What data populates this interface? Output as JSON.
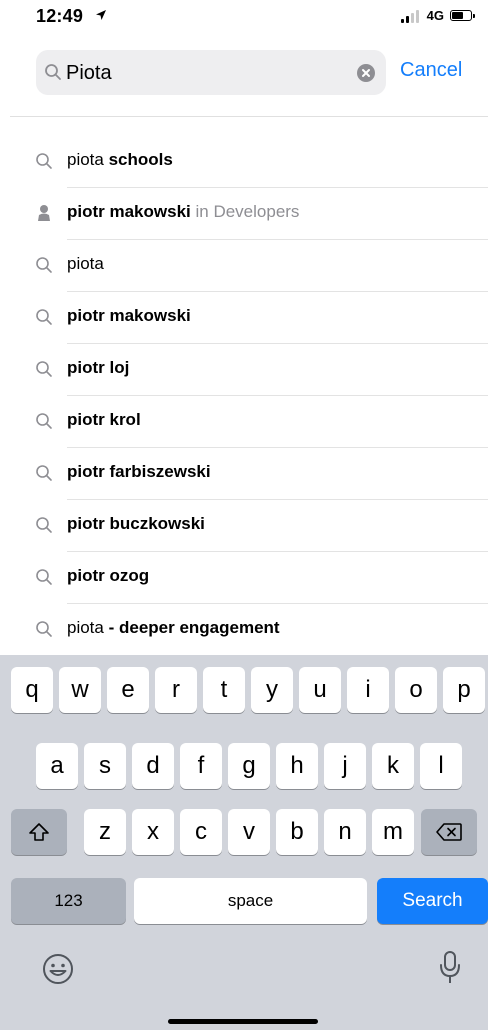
{
  "status": {
    "time": "12:49",
    "network": "4G"
  },
  "search": {
    "query": "Piota",
    "cancel_label": "Cancel"
  },
  "suggestions": [
    {
      "icon": "search-icon",
      "prefix": "piota",
      "bold": " schools",
      "context": ""
    },
    {
      "icon": "person-icon",
      "prefix": "",
      "bold": "piotr makowski",
      "context": " in Developers"
    },
    {
      "icon": "search-icon",
      "prefix": "piota",
      "bold": "",
      "context": ""
    },
    {
      "icon": "search-icon",
      "prefix": "",
      "bold": "piotr makowski",
      "context": ""
    },
    {
      "icon": "search-icon",
      "prefix": "",
      "bold": "piotr loj",
      "context": ""
    },
    {
      "icon": "search-icon",
      "prefix": "",
      "bold": "piotr krol",
      "context": ""
    },
    {
      "icon": "search-icon",
      "prefix": "",
      "bold": "piotr farbiszewski",
      "context": ""
    },
    {
      "icon": "search-icon",
      "prefix": "",
      "bold": "piotr buczkowski",
      "context": ""
    },
    {
      "icon": "search-icon",
      "prefix": "",
      "bold": "piotr ozog",
      "context": ""
    },
    {
      "icon": "search-icon",
      "prefix": "piota",
      "bold": " - deeper engagement",
      "context": ""
    }
  ],
  "keyboard": {
    "row1": [
      "q",
      "w",
      "e",
      "r",
      "t",
      "y",
      "u",
      "i",
      "o",
      "p"
    ],
    "row2": [
      "a",
      "s",
      "d",
      "f",
      "g",
      "h",
      "j",
      "k",
      "l"
    ],
    "row3": [
      "z",
      "x",
      "c",
      "v",
      "b",
      "n",
      "m"
    ],
    "numbers_label": "123",
    "space_label": "space",
    "search_label": "Search"
  },
  "colors": {
    "accent": "#147efb",
    "keyboard_bg": "#d1d4db",
    "secondary_text": "#8e8e93"
  }
}
